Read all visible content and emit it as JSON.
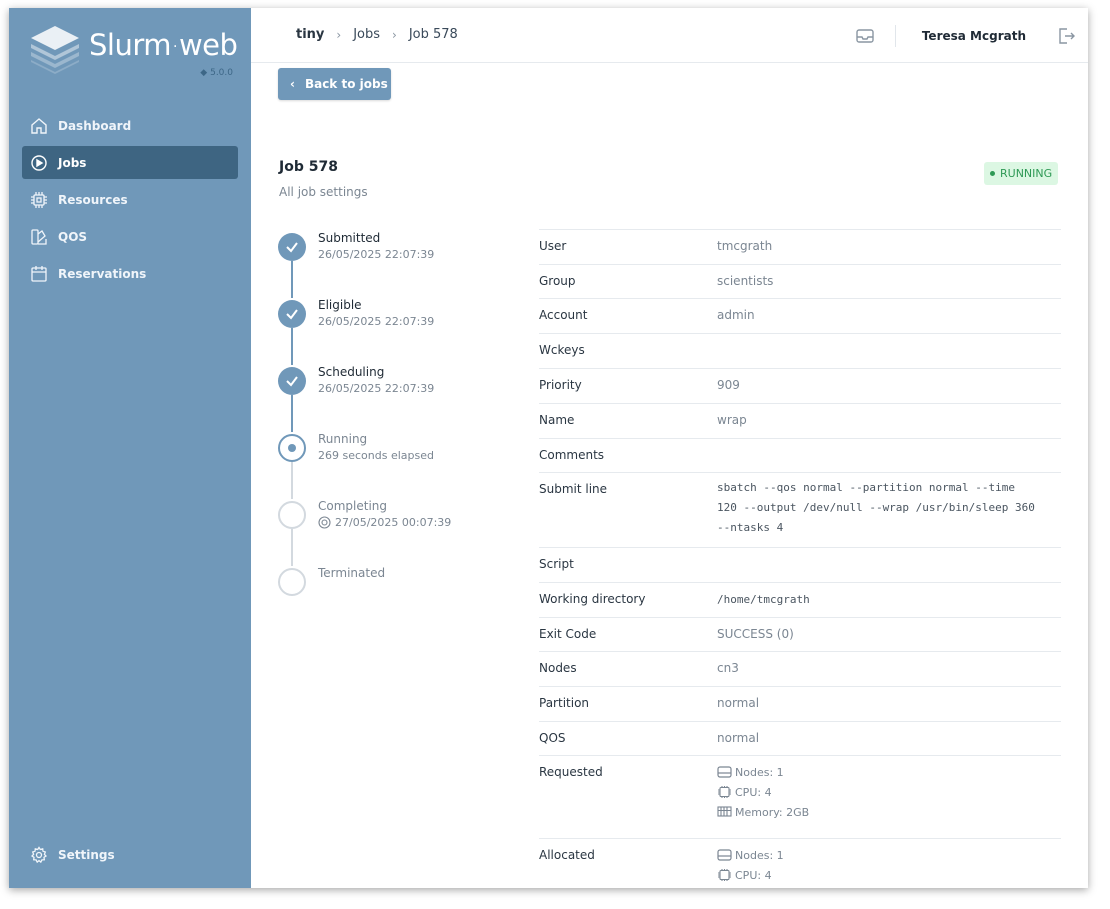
{
  "app": {
    "logo_text_1": "Slurm",
    "logo_text_2": "web",
    "logo_dot": "·",
    "version": "5.0.0"
  },
  "sidebar": {
    "items": [
      {
        "label": "Dashboard",
        "icon": "home-icon"
      },
      {
        "label": "Jobs",
        "icon": "play-circle-icon",
        "active": true
      },
      {
        "label": "Resources",
        "icon": "cpu-chip-icon"
      },
      {
        "label": "QOS",
        "icon": "swatch-icon"
      },
      {
        "label": "Reservations",
        "icon": "calendar-icon"
      }
    ],
    "settings_label": "Settings"
  },
  "topbar": {
    "breadcrumb": [
      "tiny",
      "Jobs",
      "Job 578"
    ],
    "username": "Teresa Mcgrath"
  },
  "main": {
    "back_label": "Back to jobs",
    "title": "Job 578",
    "subtitle": "All job settings",
    "status": "RUNNING",
    "colors": {
      "accent": "#7098b9",
      "sidebar_active": "#3e6582",
      "status_bg": "#dcf7e3",
      "status_fg": "#2e9955"
    }
  },
  "timeline": [
    {
      "label": "Submitted",
      "detail": "26/05/2025 22:07:39",
      "state": "done"
    },
    {
      "label": "Eligible",
      "detail": "26/05/2025 22:07:39",
      "state": "done"
    },
    {
      "label": "Scheduling",
      "detail": "26/05/2025 22:07:39",
      "state": "done"
    },
    {
      "label": "Running",
      "detail": "269 seconds elapsed",
      "state": "current"
    },
    {
      "label": "Completing",
      "detail": "27/05/2025 00:07:39",
      "state": "pending"
    },
    {
      "label": "Terminated",
      "detail": "",
      "state": "pending"
    }
  ],
  "details": {
    "user": {
      "key": "User",
      "value": "tmcgrath"
    },
    "group": {
      "key": "Group",
      "value": "scientists"
    },
    "account": {
      "key": "Account",
      "value": "admin"
    },
    "wckeys": {
      "key": "Wckeys",
      "value": ""
    },
    "priority": {
      "key": "Priority",
      "value": "909"
    },
    "name": {
      "key": "Name",
      "value": "wrap"
    },
    "comments": {
      "key": "Comments",
      "value": ""
    },
    "submit_line": {
      "key": "Submit line",
      "line1": "sbatch --qos normal --partition normal --time",
      "line2": "120 --output /dev/null --wrap /usr/bin/sleep 360",
      "line3": "--ntasks 4"
    },
    "script": {
      "key": "Script",
      "value": ""
    },
    "working_directory": {
      "key": "Working directory",
      "value": "/home/tmcgrath"
    },
    "exit_code": {
      "key": "Exit Code",
      "value": "SUCCESS (0)"
    },
    "nodes": {
      "key": "Nodes",
      "value": "cn3"
    },
    "partition": {
      "key": "Partition",
      "value": "normal"
    },
    "qos": {
      "key": "QOS",
      "value": "normal"
    },
    "requested": {
      "key": "Requested",
      "nodes": "Nodes: 1",
      "cpu": "CPU: 4",
      "memory": "Memory: 2GB"
    },
    "allocated": {
      "key": "Allocated",
      "nodes": "Nodes: 1",
      "cpu": "CPU: 4"
    }
  }
}
